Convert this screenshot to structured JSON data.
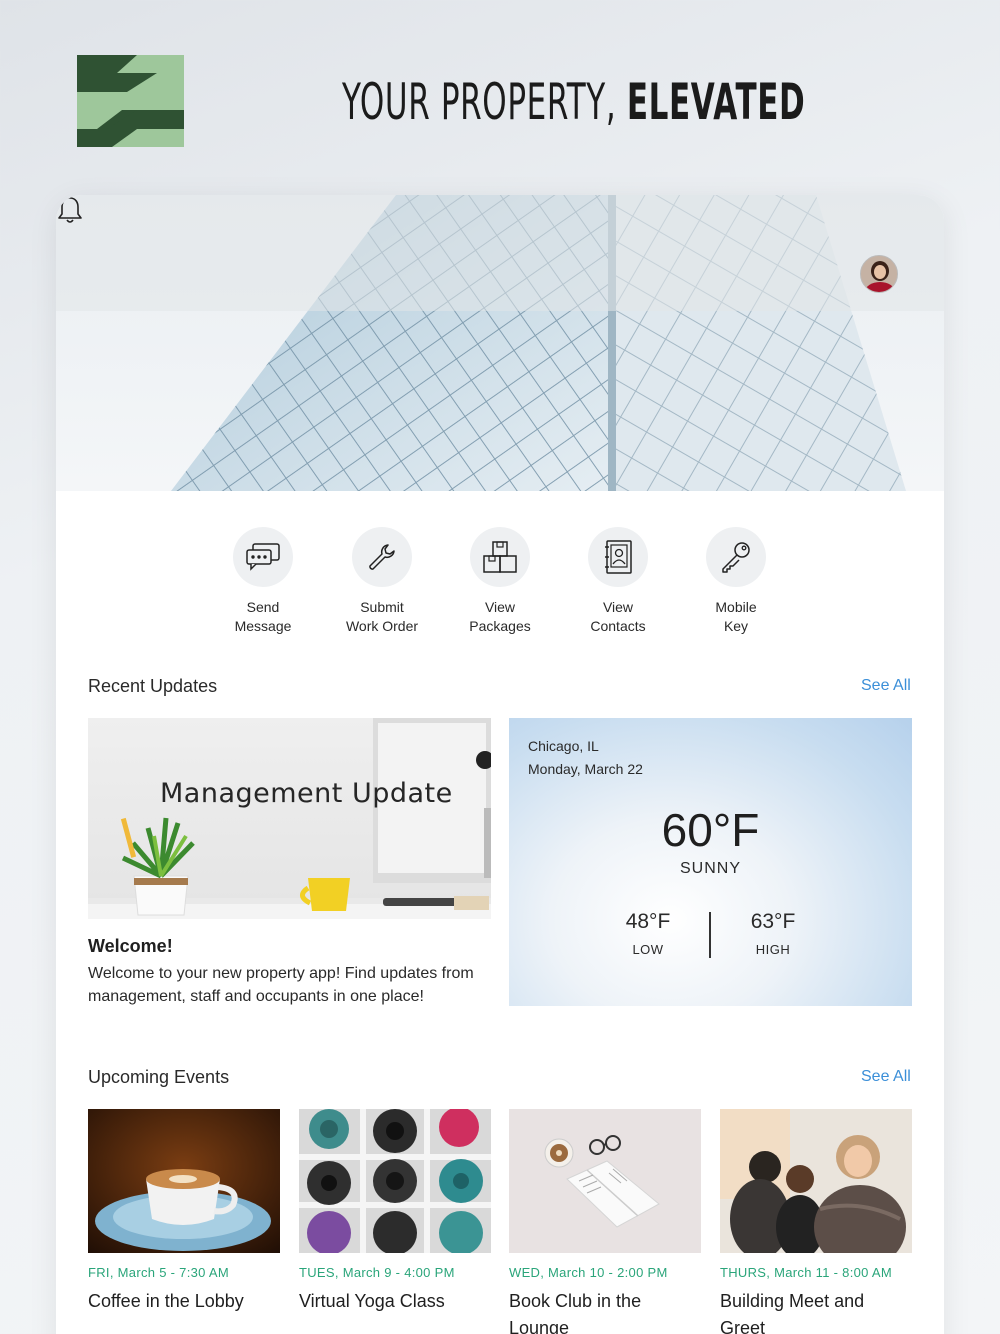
{
  "header": {
    "tagline_light": "YOUR PROPERTY,",
    "tagline_bold": "ELEVATED"
  },
  "hero": {
    "notifications_icon": "bell-icon",
    "profile_icon": "avatar"
  },
  "quick_actions": [
    {
      "label": "Send\nMessage",
      "icon": "chat-message-icon"
    },
    {
      "label": "Submit\nWork Order",
      "icon": "wrench-icon"
    },
    {
      "label": "View\nPackages",
      "icon": "package-boxes-icon"
    },
    {
      "label": "View\nContacts",
      "icon": "contacts-book-icon"
    },
    {
      "label": "Mobile\nKey",
      "icon": "key-icon"
    }
  ],
  "recent_updates": {
    "title": "Recent Updates",
    "see_all": "See All",
    "update": {
      "image_title": "Management Update",
      "heading": "Welcome!",
      "body": "Welcome to your new property app! Find updates from management, staff and occupants in one place!"
    },
    "weather": {
      "city": "Chicago, IL",
      "date": "Monday, March 22",
      "temperature": "60°F",
      "condition": "SUNNY",
      "low": "48°F",
      "low_label": "LOW",
      "high": "63°F",
      "high_label": "HIGH"
    }
  },
  "upcoming_events": {
    "title": "Upcoming Events",
    "see_all": "See All",
    "events": [
      {
        "date": "FRI, March 5 - 7:30 AM",
        "title": "Coffee in the Lobby"
      },
      {
        "date": "TUES, March 9 - 4:00 PM",
        "title": "Virtual Yoga Class"
      },
      {
        "date": "WED, March 10 - 2:00 PM",
        "title": "Book Club in the Lounge"
      },
      {
        "date": "THURS, March 11 - 8:00 AM",
        "title": "Building Meet and Greet"
      }
    ]
  },
  "colors": {
    "logo_dark": "#2f5233",
    "logo_light": "#9ec79b",
    "accent_link": "#3b8fd8",
    "event_date": "#2aa57a"
  }
}
